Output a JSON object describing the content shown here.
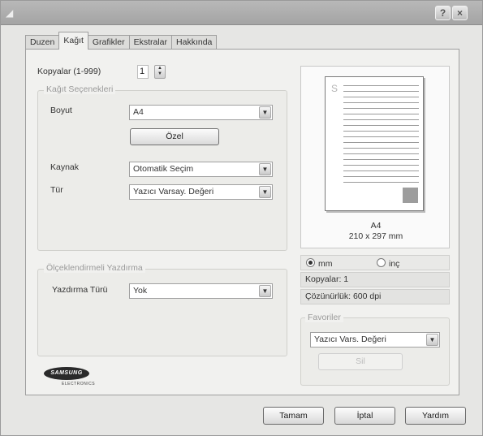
{
  "titlebar": {
    "help_symbol": "?",
    "close_symbol": "×"
  },
  "tabs": [
    {
      "label": "Duzen",
      "active": false
    },
    {
      "label": "Kağıt",
      "active": true
    },
    {
      "label": "Grafikler",
      "active": false
    },
    {
      "label": "Ekstralar",
      "active": false
    },
    {
      "label": "Hakkında",
      "active": false
    }
  ],
  "copies": {
    "label": "Kopyalar (1-999)",
    "value": "1"
  },
  "paper_options": {
    "title": "Kağıt Seçenekleri",
    "size_label": "Boyut",
    "size_value": "A4",
    "custom_button": "Özel",
    "source_label": "Kaynak",
    "source_value": "Otomatik Seçim",
    "type_label": "Tür",
    "type_value": "Yazıcı Varsay. Değeri"
  },
  "scaling": {
    "title": "Ölçeklendirmeli Yazdırma",
    "label": "Yazdırma Türü",
    "value": "Yok"
  },
  "preview": {
    "paper_name": "A4",
    "paper_dims": "210 x 297 mm",
    "unit_mm": "mm",
    "unit_inch": "inç",
    "selected_unit": "mm",
    "copies_text": "Kopyalar: 1",
    "resolution_text": "Çözünürlük: 600 dpi"
  },
  "favorites": {
    "title": "Favoriler",
    "value": "Yazıcı Vars. Değeri",
    "save_button": "Sil"
  },
  "logo": {
    "brand": "SAMSUNG",
    "sub": "ELECTRONICS"
  },
  "footer": {
    "ok": "Tamam",
    "cancel": "İptal",
    "help": "Yardım"
  }
}
